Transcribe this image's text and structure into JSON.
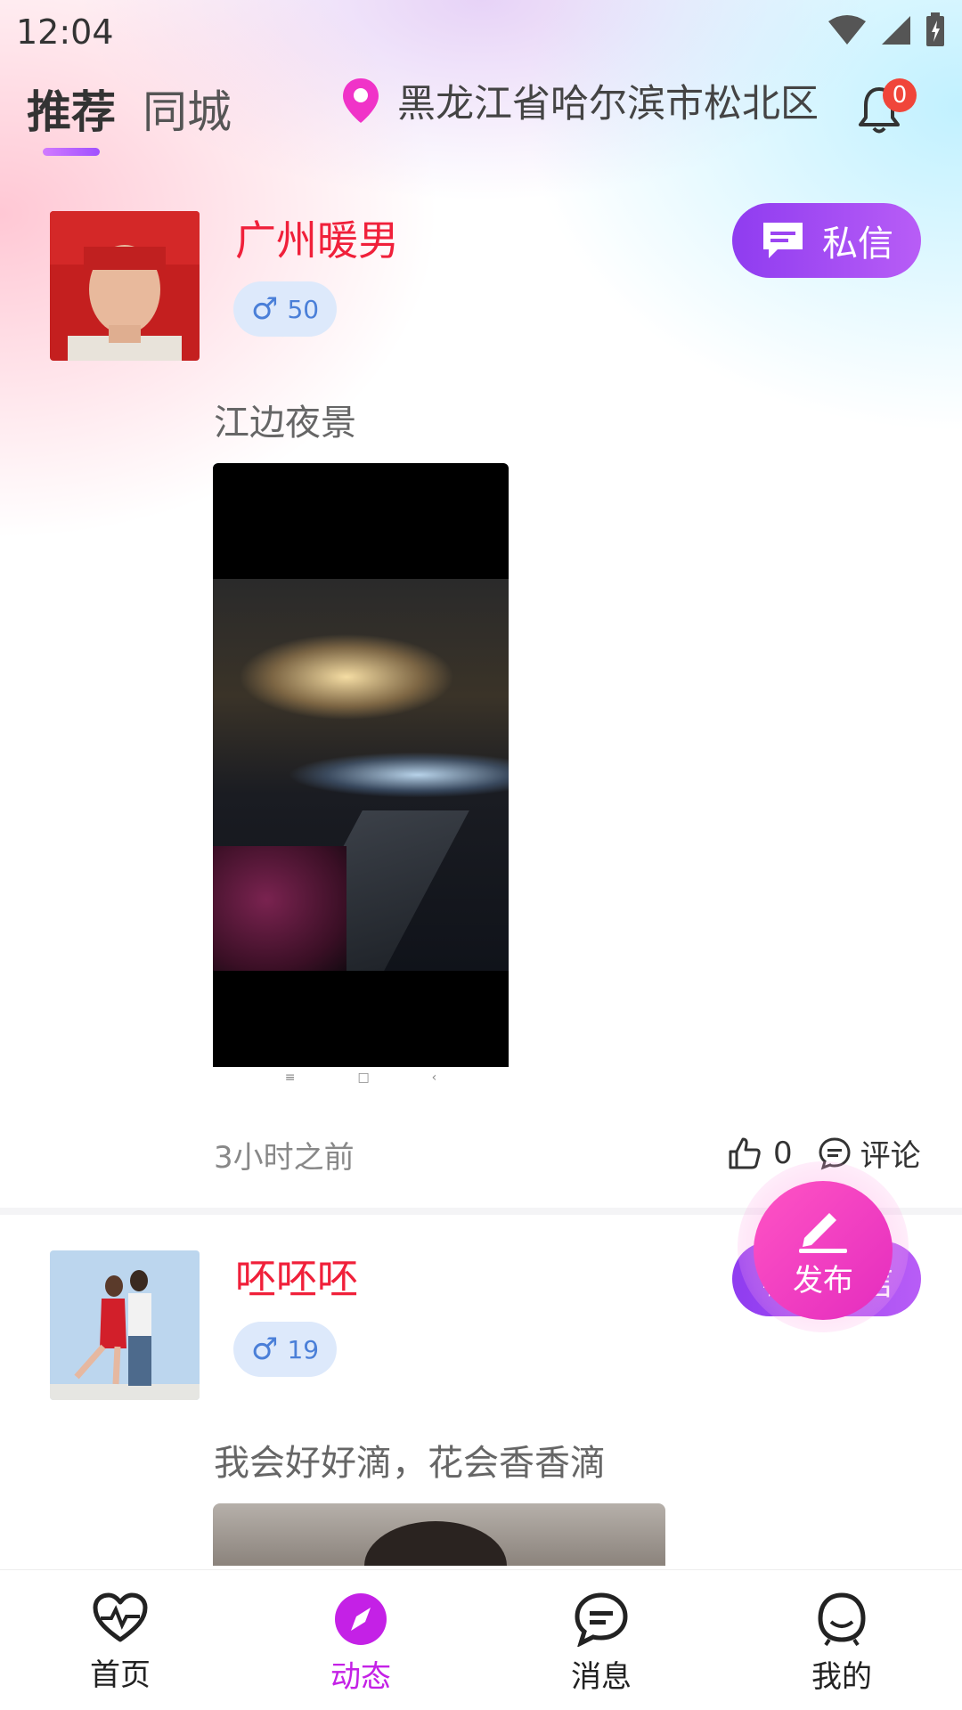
{
  "status_bar": {
    "time": "12:04"
  },
  "header": {
    "tabs": [
      {
        "label": "推荐",
        "active": true
      },
      {
        "label": "同城",
        "active": false
      }
    ],
    "location": "黑龙江省哈尔滨市松北区",
    "notification_count": "0"
  },
  "posts": [
    {
      "username": "广州暖男",
      "gender_symbol": "♂",
      "age": "50",
      "message_button": "私信",
      "text": "江边夜景",
      "time": "3小时之前",
      "likes": "0",
      "comment_label": "评论"
    },
    {
      "username": "呸呸呸",
      "gender_symbol": "♂",
      "age": "19",
      "message_button": "私信",
      "text": "我会好好滴，花会香香滴"
    }
  ],
  "fab": {
    "label": "发布"
  },
  "bottom_nav": [
    {
      "label": "首页",
      "icon": "heartbeat-icon",
      "active": false
    },
    {
      "label": "动态",
      "icon": "compass-icon",
      "active": true
    },
    {
      "label": "消息",
      "icon": "chat-icon",
      "active": false
    },
    {
      "label": "我的",
      "icon": "profile-icon",
      "active": false
    }
  ],
  "colors": {
    "accent_purple": "#9b45f2",
    "accent_pink": "#ff54c4",
    "username_red": "#f0203a",
    "active_tab": "#c421e6"
  }
}
